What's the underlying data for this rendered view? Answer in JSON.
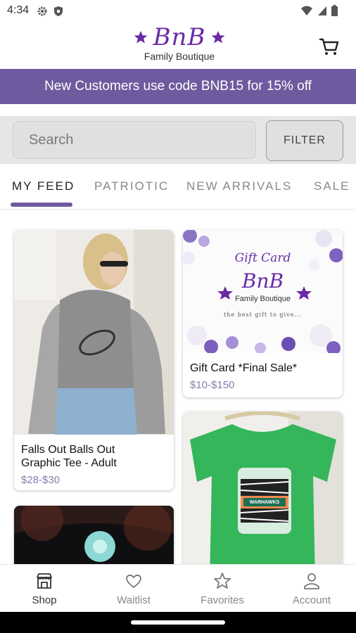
{
  "status_bar": {
    "time": "4:34"
  },
  "header": {
    "logo_brand": "BnB",
    "logo_subtitle": "Family Boutique",
    "accent_color": "#6a2aa6"
  },
  "promo": {
    "text": "New Customers use code BNB15 for 15% off",
    "color": "#6e5a9e"
  },
  "search": {
    "placeholder": "Search",
    "filter_label": "FILTER"
  },
  "tabs": [
    {
      "label": "MY FEED",
      "active": true
    },
    {
      "label": "PATRIOTIC"
    },
    {
      "label": "NEW ARRIVALS"
    },
    {
      "label": "SALE"
    }
  ],
  "products": [
    {
      "title_line1": "Falls Out Balls Out",
      "title_line2": "Graphic Tee - Adult",
      "price": "$28-$30"
    },
    {
      "title": "Gift Card *Final Sale*",
      "price": "$10-$150",
      "image_text": {
        "heading": "Gift Card",
        "brand": "BnB",
        "subtitle": "Family Boutique",
        "tagline": "the best gift to give..."
      }
    },
    {
      "image_text": {
        "print": "WARHAWKS"
      }
    },
    {}
  ],
  "bottom_nav": [
    {
      "label": "Shop",
      "icon": "shop-icon",
      "active": true
    },
    {
      "label": "Waitlist",
      "icon": "heart-icon"
    },
    {
      "label": "Favorites",
      "icon": "star-icon"
    },
    {
      "label": "Account",
      "icon": "account-icon"
    }
  ]
}
